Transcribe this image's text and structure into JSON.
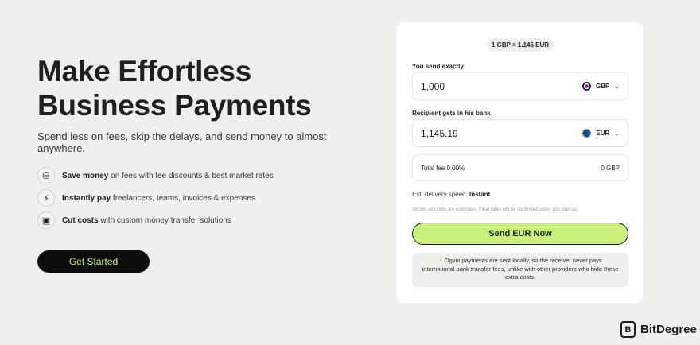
{
  "hero": {
    "title": "Make Effortless Business Payments",
    "subtitle": "Spend less on fees, skip the delays, and send money to almost anywhere.",
    "cta_label": "Get Started"
  },
  "features": [
    {
      "icon": "coins-icon",
      "glyph": "⛁",
      "bold": "Save money",
      "text": " on fees with fee discounts & best market rates"
    },
    {
      "icon": "lightning-icon",
      "glyph": "⚡",
      "bold": "Instantly pay",
      "text": " freelancers, teams, invoices & expenses"
    },
    {
      "icon": "banknote-icon",
      "glyph": "▣",
      "bold": "Cut costs",
      "text": " with custom money transfer solutions"
    }
  ],
  "converter": {
    "rate": "1 GBP = 1.145 EUR",
    "send_label": "You send exactly",
    "send_value": "1,000",
    "send_currency": "GBP",
    "receive_label": "Recipient gets in his bank",
    "receive_value": "1,145.19",
    "receive_currency": "EUR",
    "fee_label": "Total fee 0.00%",
    "fee_value": "0 GBP",
    "delivery_label": "Est. delivery speed:",
    "delivery_value": "Instant",
    "disclaimer": "Shown amounts are estimates. Final rates will be confirmed when you sign up.",
    "send_button": "Send EUR Now",
    "note": "Ogvio payments are sent locally, so the receiver never pays international bank transfer fees, unlike with other providers who hide these extra costs."
  },
  "brand": {
    "name": "BitDegree",
    "logo_glyph": "B"
  },
  "colors": {
    "background": "#eef0ec",
    "accent": "#c8f07a",
    "cta_background": "#0d0d0d"
  }
}
